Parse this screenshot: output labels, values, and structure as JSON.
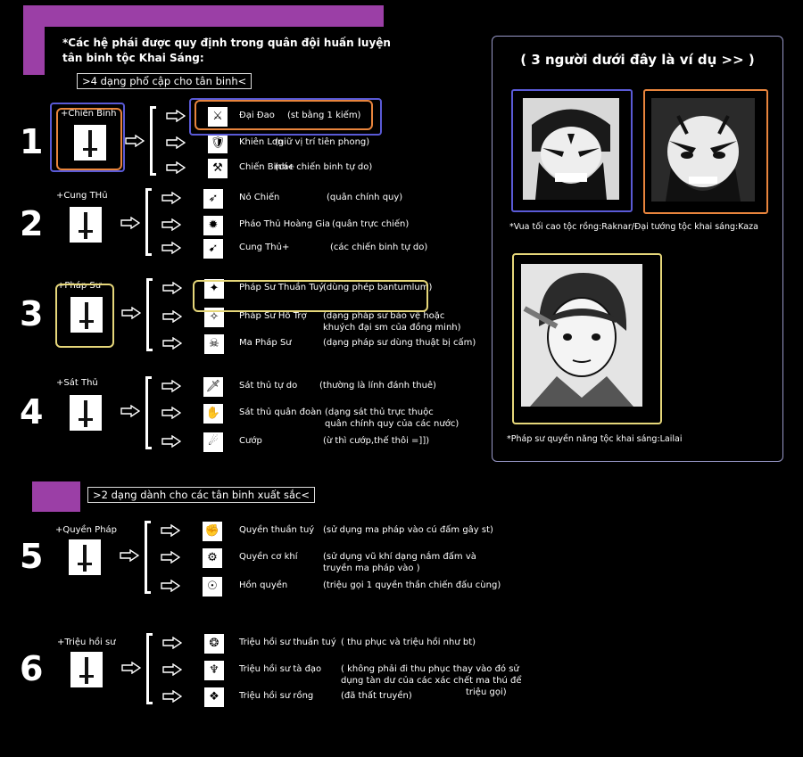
{
  "intro": {
    "line1": "*Các hệ phái được quy định trong quân đội huấn luyện",
    "line2": "tân binh tộc Khai Sáng:",
    "basic_header": ">4 dạng phổ cập cho tân binh<",
    "elite_header": ">2 dạng dành cho các tân binh xuất sắc<"
  },
  "classes": [
    {
      "number": "1",
      "name": "+Chiến Binh",
      "icon": "sword-icon",
      "subs": [
        {
          "name": "Đại Đao",
          "desc": "(st bằng 1 kiếm)",
          "icon": "greatsword-icon"
        },
        {
          "name": "Khiên Lơn",
          "desc": "(giữ vị trí tiên phong)",
          "icon": "shield-icon"
        },
        {
          "name": "Chiến Binh+",
          "desc": "(các chiến binh tự do)",
          "icon": "axe-icon"
        }
      ]
    },
    {
      "number": "2",
      "name": "+Cung THủ",
      "icon": "bow-icon",
      "subs": [
        {
          "name": "Nỏ Chiến",
          "desc": "(quân chính quy)",
          "icon": "crossbow-icon"
        },
        {
          "name": "Pháo Thủ Hoàng Gia",
          "desc": "(quân trực chiến)",
          "icon": "cannon-icon"
        },
        {
          "name": "Cung Thủ+",
          "desc": "(các chiến binh tự do)",
          "icon": "longbow-icon"
        }
      ]
    },
    {
      "number": "3",
      "name": "+Pháp Sư",
      "icon": "staff-icon",
      "subs": [
        {
          "name": "Pháp Sư Thuần Tuý",
          "desc": "(dùng phép bantumlum)",
          "icon": "wand-icon"
        },
        {
          "name": "Pháp Sư Hỗ Trợ",
          "desc": "(dạng pháp sư bảo vệ hoặc",
          "desc2": "khuých đại sm của đồng minh)",
          "icon": "support-icon"
        },
        {
          "name": "Ma Pháp Sư",
          "desc": "(dạng pháp sư dùng thuật bị cấm)",
          "icon": "dark-magic-icon"
        }
      ]
    },
    {
      "number": "4",
      "name": "+Sát Thủ",
      "icon": "dagger-icon",
      "subs": [
        {
          "name": "Sát thủ tự do",
          "desc": "(thường là lính đánh thuê)",
          "icon": "knife-icon"
        },
        {
          "name": "Sát thủ quân đoàn",
          "desc": "(dạng sát thủ trực thuộc",
          "desc2": "quân chính quy của các nước)",
          "icon": "hand-knife-icon"
        },
        {
          "name": "Cướp",
          "desc": "(ừ thì cướp,thế thôi =]])",
          "icon": "bandit-icon"
        }
      ]
    },
    {
      "number": "5",
      "name": "+Quyền Pháp",
      "icon": "fist-icon",
      "subs": [
        {
          "name": "Quyền thuần tuý",
          "desc": "(sử dụng ma pháp vào cú đấm gây st)",
          "icon": "punch-icon"
        },
        {
          "name": "Quyền cơ khí",
          "desc": "(sử dụng vũ khí dạng nắm đấm và",
          "desc2": "truyền ma pháp vào )",
          "icon": "mech-fist-icon"
        },
        {
          "name": "Hồn quyền",
          "desc": "(triệu gọi 1 quyền thần chiến đấu cùng)",
          "icon": "spirit-fighter-icon"
        }
      ]
    },
    {
      "number": "6",
      "name": "+Triệu hồi sư",
      "icon": "summon-icon",
      "subs": [
        {
          "name": "Triệu hồi sư thuần tuý",
          "desc": "( thu phục và triệu hồi như bt)",
          "icon": "beast-icon"
        },
        {
          "name": "Triệu hồi sư tà đạo",
          "desc": "( không phải đi thu phục thay vào đó sử",
          "desc2": "dụng tàn dư của các xác chết ma thú để",
          "desc3": "triệu gọi)",
          "icon": "necro-icon"
        },
        {
          "name": "Triệu hồi sư rồng",
          "desc": "(đã thất truyền)",
          "icon": "dragon-icon"
        }
      ]
    }
  ],
  "examples": {
    "title": "( 3 người dưới đây là ví dụ >> )",
    "caption1": "*Vua tối cao tộc rồng:Raknar/Đại tướng tộc khai sáng:Kaza",
    "caption2": "*Pháp sư quyền năng tộc khai sáng:Lailai"
  },
  "colors": {
    "purple": "#9b3fa6",
    "orange": "#e8843c",
    "blue": "#5a5ad6",
    "yellow": "#e6d77a",
    "panel_border": "#9898c8"
  }
}
